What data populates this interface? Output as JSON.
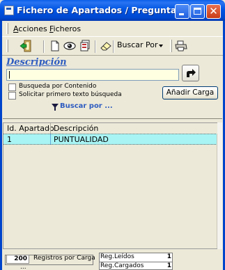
{
  "window": {
    "title": "Fichero de Apartados / Preguntas"
  },
  "menu": {
    "items": [
      {
        "label": "Acciones"
      },
      {
        "label": "Ficheros"
      }
    ]
  },
  "toolbar": {
    "buscar_por_label": "Buscar Por",
    "icons": [
      "exit-icon",
      "new-document-icon",
      "view-icon",
      "pages-icon",
      "eraser-icon",
      "print-icon"
    ]
  },
  "search": {
    "label": "Descripción",
    "value": "",
    "option_contenido": "Busqueda por Contenido",
    "option_primero": "Solicitar primero texto búsqueda",
    "buscar_por_link": "Buscar por ...",
    "anadir_carga_label": "Añadir Carga",
    "input_bg": "#ffffe1",
    "label_color": "#2e5cc0"
  },
  "grid": {
    "columns": [
      "Id. Apartado",
      "Descripción"
    ],
    "rows": [
      {
        "id": "1",
        "descripcion": "PUNTUALIDAD"
      }
    ],
    "selected_row_color": "#a8f4f4"
  },
  "status": {
    "registros_por_carga_value": "200",
    "registros_por_carga_label": "Registros por Carga",
    "partial_label": "...",
    "reg_leidos_label": "Reg.Leídos",
    "reg_leidos_value": "1",
    "reg_cargados_label": "Reg.Cargados",
    "reg_cargados_value": "1"
  }
}
